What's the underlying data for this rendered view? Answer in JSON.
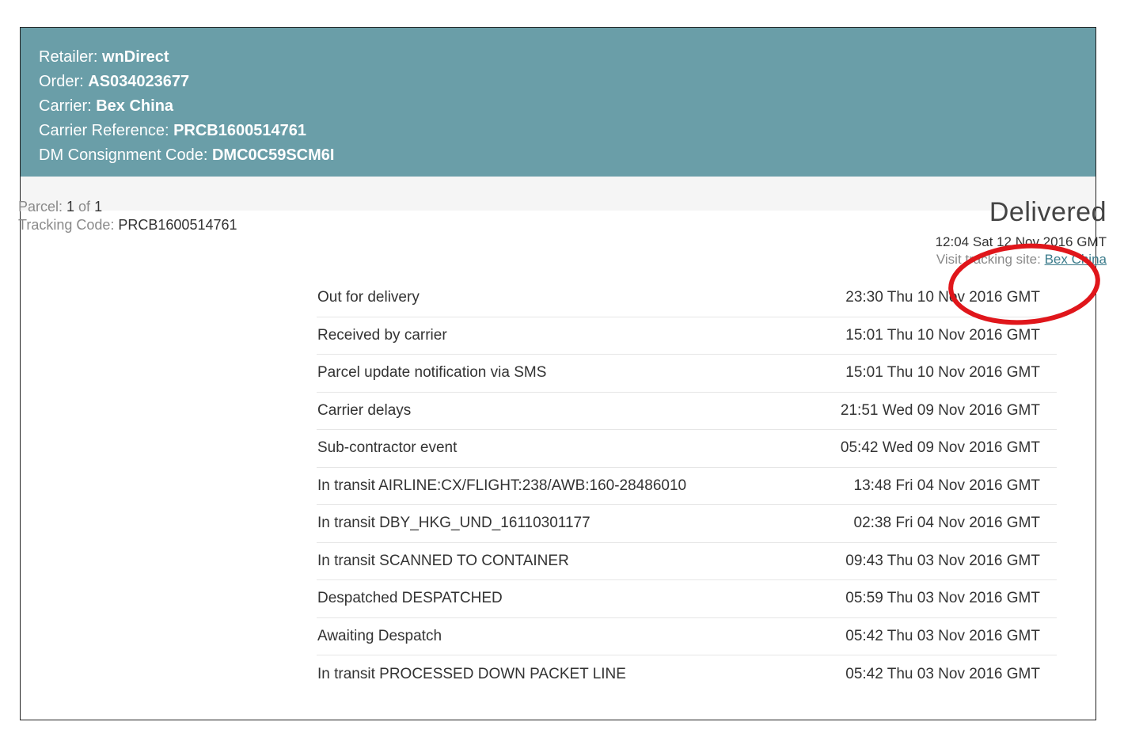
{
  "header": {
    "retailer_label": "Retailer: ",
    "retailer": "wnDirect",
    "order_label": "Order: ",
    "order": "AS034023677",
    "carrier_label": "Carrier: ",
    "carrier": "Bex China",
    "carrier_ref_label": "Carrier Reference: ",
    "carrier_ref": "PRCB1600514761",
    "dm_code_label": "DM Consignment Code: ",
    "dm_code": "DMC0C59SCM6I"
  },
  "parcel": {
    "parcel_label": "Parcel: ",
    "parcel_num": "1",
    "of_label": " of ",
    "parcel_total": "1",
    "tracking_label": "Tracking Code: ",
    "tracking_code": "PRCB1600514761"
  },
  "status": {
    "title": "Delivered",
    "timestamp": "12:04 Sat 12 Nov 2016 GMT",
    "visit_label": "Visit tracking site: ",
    "visit_link": "Bex China"
  },
  "events": [
    {
      "desc": "Out for delivery",
      "time": "23:30 Thu 10 Nov 2016 GMT"
    },
    {
      "desc": "Received by carrier",
      "time": "15:01 Thu 10 Nov 2016 GMT"
    },
    {
      "desc": "Parcel update notification via SMS",
      "time": "15:01 Thu 10 Nov 2016 GMT"
    },
    {
      "desc": "Carrier delays",
      "time": "21:51 Wed 09 Nov 2016 GMT"
    },
    {
      "desc": "Sub-contractor event",
      "time": "05:42 Wed 09 Nov 2016 GMT"
    },
    {
      "desc": "In transit AIRLINE:CX/FLIGHT:238/AWB:160-28486010",
      "time": "13:48 Fri 04 Nov 2016 GMT"
    },
    {
      "desc": "In transit DBY_HKG_UND_16110301177",
      "time": "02:38 Fri 04 Nov 2016 GMT"
    },
    {
      "desc": "In transit SCANNED TO CONTAINER",
      "time": "09:43 Thu 03 Nov 2016 GMT"
    },
    {
      "desc": "Despatched DESPATCHED",
      "time": "05:59 Thu 03 Nov 2016 GMT"
    },
    {
      "desc": "Awaiting Despatch",
      "time": "05:42 Thu 03 Nov 2016 GMT"
    },
    {
      "desc": "In transit PROCESSED DOWN PACKET LINE",
      "time": "05:42 Thu 03 Nov 2016 GMT"
    }
  ],
  "colors": {
    "header_bg": "#6a9ea8",
    "link": "#3c7c8c",
    "highlight": "#e0161b"
  }
}
